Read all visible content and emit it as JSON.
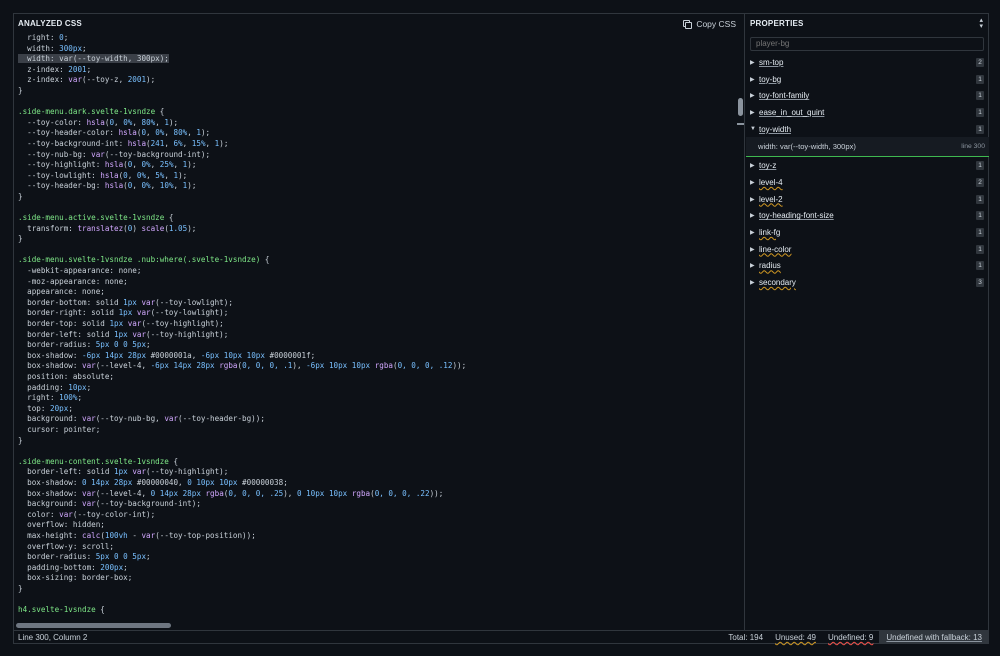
{
  "analyzed": {
    "title": "ANALYZED CSS",
    "copy_label": "Copy CSS",
    "code_lines": [
      [
        [
          "prop",
          "  right: "
        ],
        [
          "num",
          "0"
        ],
        [
          "prop",
          ";"
        ]
      ],
      [
        [
          "prop",
          "  width: "
        ],
        [
          "num",
          "300px"
        ],
        [
          "prop",
          ";"
        ]
      ],
      [
        [
          "hl",
          "  width: var(--toy-width, 300px);"
        ]
      ],
      [
        [
          "prop",
          "  z-index: "
        ],
        [
          "num",
          "2001"
        ],
        [
          "prop",
          ";"
        ]
      ],
      [
        [
          "prop",
          "  z-index: "
        ],
        [
          "fn",
          "var"
        ],
        [
          "prop",
          "(--toy-z, "
        ],
        [
          "num",
          "2001"
        ],
        [
          "prop",
          ");"
        ]
      ],
      [
        [
          "prop",
          "}"
        ]
      ],
      [
        [
          "prop",
          ""
        ]
      ],
      [
        [
          "sel",
          ".side-menu.dark.svelte-1vsndze"
        ],
        [
          "prop",
          " {"
        ]
      ],
      [
        [
          "prop",
          "  --toy-color: "
        ],
        [
          "fn",
          "hsla"
        ],
        [
          "prop",
          "("
        ],
        [
          "num",
          "0"
        ],
        [
          "prop",
          ", "
        ],
        [
          "num",
          "0%"
        ],
        [
          "prop",
          ", "
        ],
        [
          "num",
          "80%"
        ],
        [
          "prop",
          ", "
        ],
        [
          "num",
          "1"
        ],
        [
          "prop",
          ");"
        ]
      ],
      [
        [
          "prop",
          "  --toy-header-color: "
        ],
        [
          "fn",
          "hsla"
        ],
        [
          "prop",
          "("
        ],
        [
          "num",
          "0"
        ],
        [
          "prop",
          ", "
        ],
        [
          "num",
          "0%"
        ],
        [
          "prop",
          ", "
        ],
        [
          "num",
          "80%"
        ],
        [
          "prop",
          ", "
        ],
        [
          "num",
          "1"
        ],
        [
          "prop",
          ");"
        ]
      ],
      [
        [
          "prop",
          "  --toy-background-int: "
        ],
        [
          "fn",
          "hsla"
        ],
        [
          "prop",
          "("
        ],
        [
          "num",
          "241"
        ],
        [
          "prop",
          ", "
        ],
        [
          "num",
          "6%"
        ],
        [
          "prop",
          ", "
        ],
        [
          "num",
          "15%"
        ],
        [
          "prop",
          ", "
        ],
        [
          "num",
          "1"
        ],
        [
          "prop",
          ");"
        ]
      ],
      [
        [
          "prop",
          "  --toy-nub-bg: "
        ],
        [
          "fn",
          "var"
        ],
        [
          "prop",
          "(--toy-background-int);"
        ]
      ],
      [
        [
          "prop",
          "  --toy-highlight: "
        ],
        [
          "fn",
          "hsla"
        ],
        [
          "prop",
          "("
        ],
        [
          "num",
          "0"
        ],
        [
          "prop",
          ", "
        ],
        [
          "num",
          "0%"
        ],
        [
          "prop",
          ", "
        ],
        [
          "num",
          "25%"
        ],
        [
          "prop",
          ", "
        ],
        [
          "num",
          "1"
        ],
        [
          "prop",
          ");"
        ]
      ],
      [
        [
          "prop",
          "  --toy-lowlight: "
        ],
        [
          "fn",
          "hsla"
        ],
        [
          "prop",
          "("
        ],
        [
          "num",
          "0"
        ],
        [
          "prop",
          ", "
        ],
        [
          "num",
          "0%"
        ],
        [
          "prop",
          ", "
        ],
        [
          "num",
          "5%"
        ],
        [
          "prop",
          ", "
        ],
        [
          "num",
          "1"
        ],
        [
          "prop",
          ");"
        ]
      ],
      [
        [
          "prop",
          "  --toy-header-bg: "
        ],
        [
          "fn",
          "hsla"
        ],
        [
          "prop",
          "("
        ],
        [
          "num",
          "0"
        ],
        [
          "prop",
          ", "
        ],
        [
          "num",
          "0%"
        ],
        [
          "prop",
          ", "
        ],
        [
          "num",
          "10%"
        ],
        [
          "prop",
          ", "
        ],
        [
          "num",
          "1"
        ],
        [
          "prop",
          ");"
        ]
      ],
      [
        [
          "prop",
          "}"
        ]
      ],
      [
        [
          "prop",
          ""
        ]
      ],
      [
        [
          "sel",
          ".side-menu.active.svelte-1vsndze"
        ],
        [
          "prop",
          " {"
        ]
      ],
      [
        [
          "prop",
          "  transform: "
        ],
        [
          "fn",
          "translatez"
        ],
        [
          "prop",
          "("
        ],
        [
          "num",
          "0"
        ],
        [
          "prop",
          ") "
        ],
        [
          "fn",
          "scale"
        ],
        [
          "prop",
          "("
        ],
        [
          "num",
          "1.05"
        ],
        [
          "prop",
          ");"
        ]
      ],
      [
        [
          "prop",
          "}"
        ]
      ],
      [
        [
          "prop",
          ""
        ]
      ],
      [
        [
          "sel",
          ".side-menu.svelte-1vsndze .nub:where(.svelte-1vsndze)"
        ],
        [
          "prop",
          " {"
        ]
      ],
      [
        [
          "prop",
          "  -webkit-appearance: none;"
        ]
      ],
      [
        [
          "prop",
          "  -moz-appearance: none;"
        ]
      ],
      [
        [
          "prop",
          "  appearance: none;"
        ]
      ],
      [
        [
          "prop",
          "  border-bottom: solid "
        ],
        [
          "num",
          "1px"
        ],
        [
          "prop",
          " "
        ],
        [
          "fn",
          "var"
        ],
        [
          "prop",
          "(--toy-lowlight);"
        ]
      ],
      [
        [
          "prop",
          "  border-right: solid "
        ],
        [
          "num",
          "1px"
        ],
        [
          "prop",
          " "
        ],
        [
          "fn",
          "var"
        ],
        [
          "prop",
          "(--toy-lowlight);"
        ]
      ],
      [
        [
          "prop",
          "  border-top: solid "
        ],
        [
          "num",
          "1px"
        ],
        [
          "prop",
          " "
        ],
        [
          "fn",
          "var"
        ],
        [
          "prop",
          "(--toy-highlight);"
        ]
      ],
      [
        [
          "prop",
          "  border-left: solid "
        ],
        [
          "num",
          "1px"
        ],
        [
          "prop",
          " "
        ],
        [
          "fn",
          "var"
        ],
        [
          "prop",
          "(--toy-highlight);"
        ]
      ],
      [
        [
          "prop",
          "  border-radius: "
        ],
        [
          "num",
          "5px 0 0 5px"
        ],
        [
          "prop",
          ";"
        ]
      ],
      [
        [
          "prop",
          "  box-shadow: "
        ],
        [
          "num",
          "-6px 14px 28px"
        ],
        [
          "prop",
          " #0000001a, "
        ],
        [
          "num",
          "-6px 10px 10px"
        ],
        [
          "prop",
          " #0000001f;"
        ]
      ],
      [
        [
          "prop",
          "  box-shadow: "
        ],
        [
          "fn",
          "var"
        ],
        [
          "prop",
          "(--level-4, "
        ],
        [
          "num",
          "-6px 14px 28px"
        ],
        [
          "prop",
          " "
        ],
        [
          "fn",
          "rgba"
        ],
        [
          "prop",
          "("
        ],
        [
          "num",
          "0, 0, 0, .1"
        ],
        [
          "prop",
          "), "
        ],
        [
          "num",
          "-6px 10px 10px"
        ],
        [
          "prop",
          " "
        ],
        [
          "fn",
          "rgba"
        ],
        [
          "prop",
          "("
        ],
        [
          "num",
          "0, 0, 0, .12"
        ],
        [
          "prop",
          "));"
        ]
      ],
      [
        [
          "prop",
          "  position: absolute;"
        ]
      ],
      [
        [
          "prop",
          "  padding: "
        ],
        [
          "num",
          "10px"
        ],
        [
          "prop",
          ";"
        ]
      ],
      [
        [
          "prop",
          "  right: "
        ],
        [
          "num",
          "100%"
        ],
        [
          "prop",
          ";"
        ]
      ],
      [
        [
          "prop",
          "  top: "
        ],
        [
          "num",
          "20px"
        ],
        [
          "prop",
          ";"
        ]
      ],
      [
        [
          "prop",
          "  background: "
        ],
        [
          "fn",
          "var"
        ],
        [
          "prop",
          "(--toy-nub-bg, "
        ],
        [
          "fn",
          "var"
        ],
        [
          "prop",
          "(--toy-header-bg));"
        ]
      ],
      [
        [
          "prop",
          "  cursor: pointer;"
        ]
      ],
      [
        [
          "prop",
          "}"
        ]
      ],
      [
        [
          "prop",
          ""
        ]
      ],
      [
        [
          "sel",
          ".side-menu-content.svelte-1vsndze"
        ],
        [
          "prop",
          " {"
        ]
      ],
      [
        [
          "prop",
          "  border-left: solid "
        ],
        [
          "num",
          "1px"
        ],
        [
          "prop",
          " "
        ],
        [
          "fn",
          "var"
        ],
        [
          "prop",
          "(--toy-highlight);"
        ]
      ],
      [
        [
          "prop",
          "  box-shadow: "
        ],
        [
          "num",
          "0 14px 28px"
        ],
        [
          "prop",
          " #00000040, "
        ],
        [
          "num",
          "0 10px 10px"
        ],
        [
          "prop",
          " #00000038;"
        ]
      ],
      [
        [
          "prop",
          "  box-shadow: "
        ],
        [
          "fn",
          "var"
        ],
        [
          "prop",
          "(--level-4, "
        ],
        [
          "num",
          "0 14px 28px"
        ],
        [
          "prop",
          " "
        ],
        [
          "fn",
          "rgba"
        ],
        [
          "prop",
          "("
        ],
        [
          "num",
          "0, 0, 0, .25"
        ],
        [
          "prop",
          "), "
        ],
        [
          "num",
          "0 10px 10px"
        ],
        [
          "prop",
          " "
        ],
        [
          "fn",
          "rgba"
        ],
        [
          "prop",
          "("
        ],
        [
          "num",
          "0, 0, 0, .22"
        ],
        [
          "prop",
          "));"
        ]
      ],
      [
        [
          "prop",
          "  background: "
        ],
        [
          "fn",
          "var"
        ],
        [
          "prop",
          "(--toy-background-int);"
        ]
      ],
      [
        [
          "prop",
          "  color: "
        ],
        [
          "fn",
          "var"
        ],
        [
          "prop",
          "(--toy-color-int);"
        ]
      ],
      [
        [
          "prop",
          "  overflow: hidden;"
        ]
      ],
      [
        [
          "prop",
          "  max-height: "
        ],
        [
          "fn",
          "calc"
        ],
        [
          "prop",
          "("
        ],
        [
          "num",
          "100vh"
        ],
        [
          "prop",
          " - "
        ],
        [
          "fn",
          "var"
        ],
        [
          "prop",
          "(--toy-top-position));"
        ]
      ],
      [
        [
          "prop",
          "  overflow-y: scroll;"
        ]
      ],
      [
        [
          "prop",
          "  border-radius: "
        ],
        [
          "num",
          "5px 0 0 5px"
        ],
        [
          "prop",
          ";"
        ]
      ],
      [
        [
          "prop",
          "  padding-bottom: "
        ],
        [
          "num",
          "200px"
        ],
        [
          "prop",
          ";"
        ]
      ],
      [
        [
          "prop",
          "  box-sizing: border-box;"
        ]
      ],
      [
        [
          "prop",
          "}"
        ]
      ],
      [
        [
          "prop",
          ""
        ]
      ],
      [
        [
          "sel",
          "h4.svelte-1vsndze"
        ],
        [
          "prop",
          " {"
        ]
      ]
    ]
  },
  "properties": {
    "title": "PROPERTIES",
    "sort_icon": "sort-arrows-icon",
    "search_value": "",
    "search_placeholder": "player-bg",
    "items": [
      {
        "name": "sm-top",
        "count": "2",
        "warn": false,
        "expanded": false
      },
      {
        "name": "toy-bg",
        "count": "1",
        "warn": false,
        "expanded": false
      },
      {
        "name": "toy-font-family",
        "count": "1",
        "warn": false,
        "expanded": false
      },
      {
        "name": "ease_in_out_quint",
        "count": "1",
        "warn": false,
        "expanded": false
      },
      {
        "name": "toy-width",
        "count": "1",
        "warn": false,
        "expanded": true,
        "detail": "width: var(--toy-width, 300px)",
        "detail_line": "line 300"
      },
      {
        "name": "toy-z",
        "count": "1",
        "warn": false,
        "expanded": false
      },
      {
        "name": "level-4",
        "count": "2",
        "warn": true,
        "expanded": false
      },
      {
        "name": "level-2",
        "count": "1",
        "warn": true,
        "expanded": false
      },
      {
        "name": "toy-heading-font-size",
        "count": "1",
        "warn": false,
        "expanded": false
      },
      {
        "name": "link-fg",
        "count": "1",
        "warn": true,
        "expanded": false
      },
      {
        "name": "line-color",
        "count": "1",
        "warn": true,
        "expanded": false
      },
      {
        "name": "radius",
        "count": "1",
        "warn": true,
        "expanded": false
      },
      {
        "name": "secondary",
        "count": "3",
        "warn": true,
        "expanded": false
      }
    ]
  },
  "status": {
    "position": "Line 300, Column 2",
    "total": "Total: 194",
    "unused": "Unused: 49",
    "undefined": "Undefined: 9",
    "fallback": "Undefined with fallback: 13"
  },
  "colors": {
    "background": "#0d1117",
    "border": "#30363d",
    "selector": "#7ee787",
    "number": "#79c0ff",
    "function": "#d2a8ff",
    "accent_green": "#3fb950",
    "warn_yellow": "#d29922",
    "error_red": "#f85149"
  }
}
